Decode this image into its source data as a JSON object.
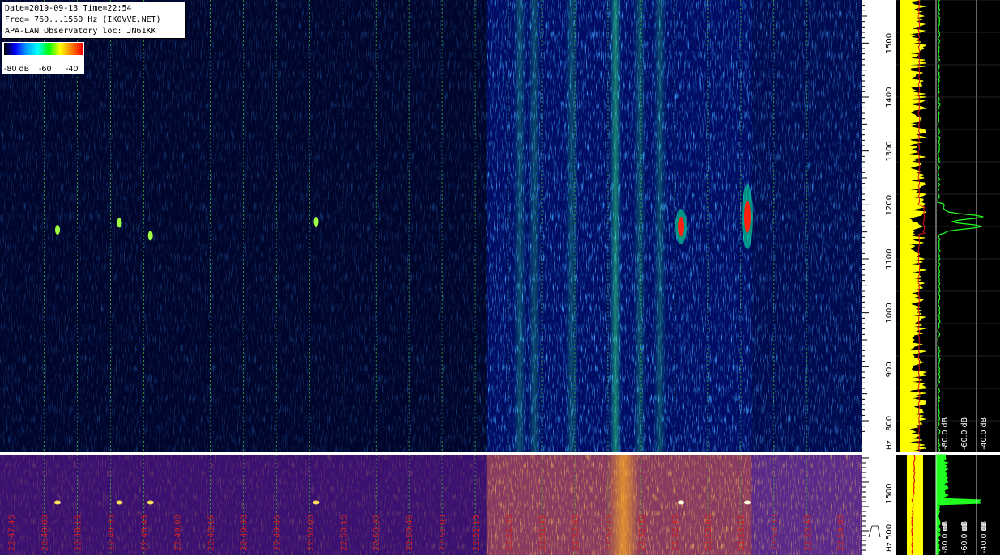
{
  "header": {
    "line1": "Date=2019-09-13 Time=22:54",
    "line2": "Freq= 760...1560 Hz (IK0VVE.NET)",
    "line3": "APA-LAN Observatory loc: JN61KK"
  },
  "legend": {
    "labels": [
      "-80 dB",
      "-60",
      "-40"
    ],
    "colors": [
      "#000000",
      "#0000ff",
      "#00a0ff",
      "#00ffff",
      "#00ff00",
      "#ffff00",
      "#ff8000",
      "#ff0000"
    ]
  },
  "chart_data": {
    "type": "heatmap",
    "title": "",
    "freq_range_hz": [
      760,
      1560
    ],
    "y_ticks_hz": [
      800,
      900,
      1000,
      1100,
      1200,
      1300,
      1400,
      1500
    ],
    "y_unit": "Hz",
    "spectrum_db_labels": [
      "-80.0 dB",
      "-60.0 dB",
      "-40.0 dB"
    ],
    "lower_y_ticks": [
      "1500",
      "500"
    ],
    "lower_y_unit": "Hz",
    "lower_db_labels": [
      "-80.0 dB",
      "-60.0 dB",
      "-40.0 dB"
    ],
    "time_labels": [
      "22:47:45",
      "22:48:00",
      "22:48:15",
      "22:48:30",
      "22:48:45",
      "22:49:00",
      "22:49:15",
      "22:49:30",
      "22:49:45",
      "22:50:00",
      "22:50:15",
      "22:50:30",
      "22:50:45",
      "22:51:00",
      "22:51:15",
      "22:51:30",
      "22:51:45",
      "22:52:00",
      "22:52:15",
      "22:52:30",
      "22:52:45",
      "22:53:00",
      "22:53:15",
      "22:53:30",
      "22:53:45",
      "22:54:00"
    ],
    "time_range": [
      "22:47:40",
      "22:54:10"
    ],
    "meteor_echoes": [
      {
        "time": "22:48:06",
        "freq_hz": 1154,
        "strength": "weak"
      },
      {
        "time": "22:48:34",
        "freq_hz": 1167,
        "strength": "weak"
      },
      {
        "time": "22:48:48",
        "freq_hz": 1143,
        "strength": "weak"
      },
      {
        "time": "22:50:03",
        "freq_hz": 1169,
        "strength": "weak"
      },
      {
        "time": "22:52:48",
        "freq_hz": 1160,
        "strength": "strong"
      },
      {
        "time": "22:53:18",
        "freq_hz": 1178,
        "strength": "strong"
      }
    ],
    "noise_bands": [
      {
        "from": "22:47:40",
        "to": "22:51:20",
        "level": "low"
      },
      {
        "from": "22:51:20",
        "to": "22:53:20",
        "level": "high"
      },
      {
        "from": "22:53:20",
        "to": "22:54:10",
        "level": "medium"
      }
    ],
    "peak_trace_hz": [
      1160,
      1178
    ]
  }
}
